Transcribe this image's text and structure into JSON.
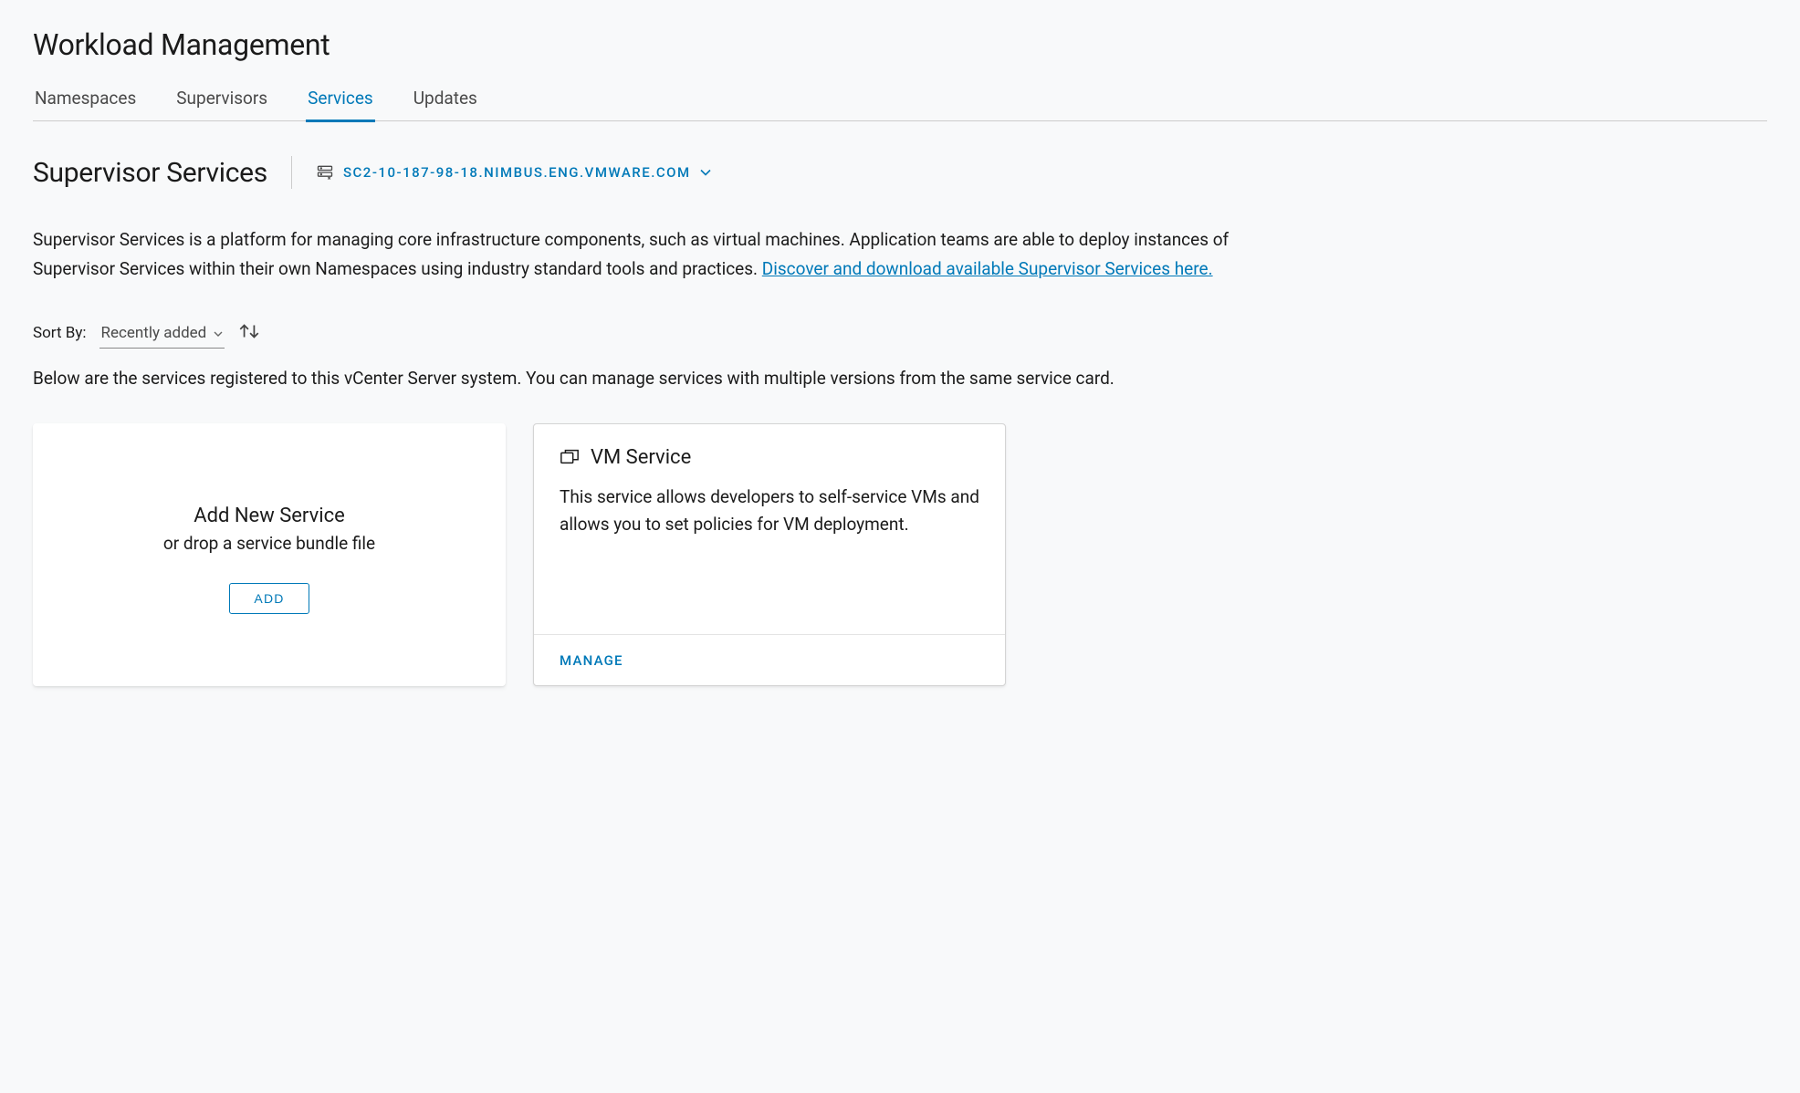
{
  "page": {
    "title": "Workload Management"
  },
  "tabs": [
    {
      "label": "Namespaces",
      "active": false
    },
    {
      "label": "Supervisors",
      "active": false
    },
    {
      "label": "Services",
      "active": true
    },
    {
      "label": "Updates",
      "active": false
    }
  ],
  "section": {
    "title": "Supervisor Services",
    "server": "SC2-10-187-98-18.NIMBUS.ENG.VMWARE.COM",
    "description_pre": "Supervisor Services is a platform for managing core infrastructure components, such as virtual machines. Application teams are able to deploy instances of Supervisor Services within their own Namespaces using industry standard tools and practices. ",
    "description_link": "Discover and download available Supervisor Services here."
  },
  "sort": {
    "label": "Sort By:",
    "selected": "Recently added"
  },
  "subtext": "Below are the services registered to this vCenter Server system. You can manage services with multiple versions from the same service card.",
  "addCard": {
    "title": "Add New Service",
    "subtitle": "or drop a service bundle file",
    "button": "ADD"
  },
  "services": [
    {
      "name": "VM Service",
      "description": "This service allows developers to self-service VMs and allows you to set policies for VM deployment.",
      "action": "MANAGE"
    }
  ]
}
